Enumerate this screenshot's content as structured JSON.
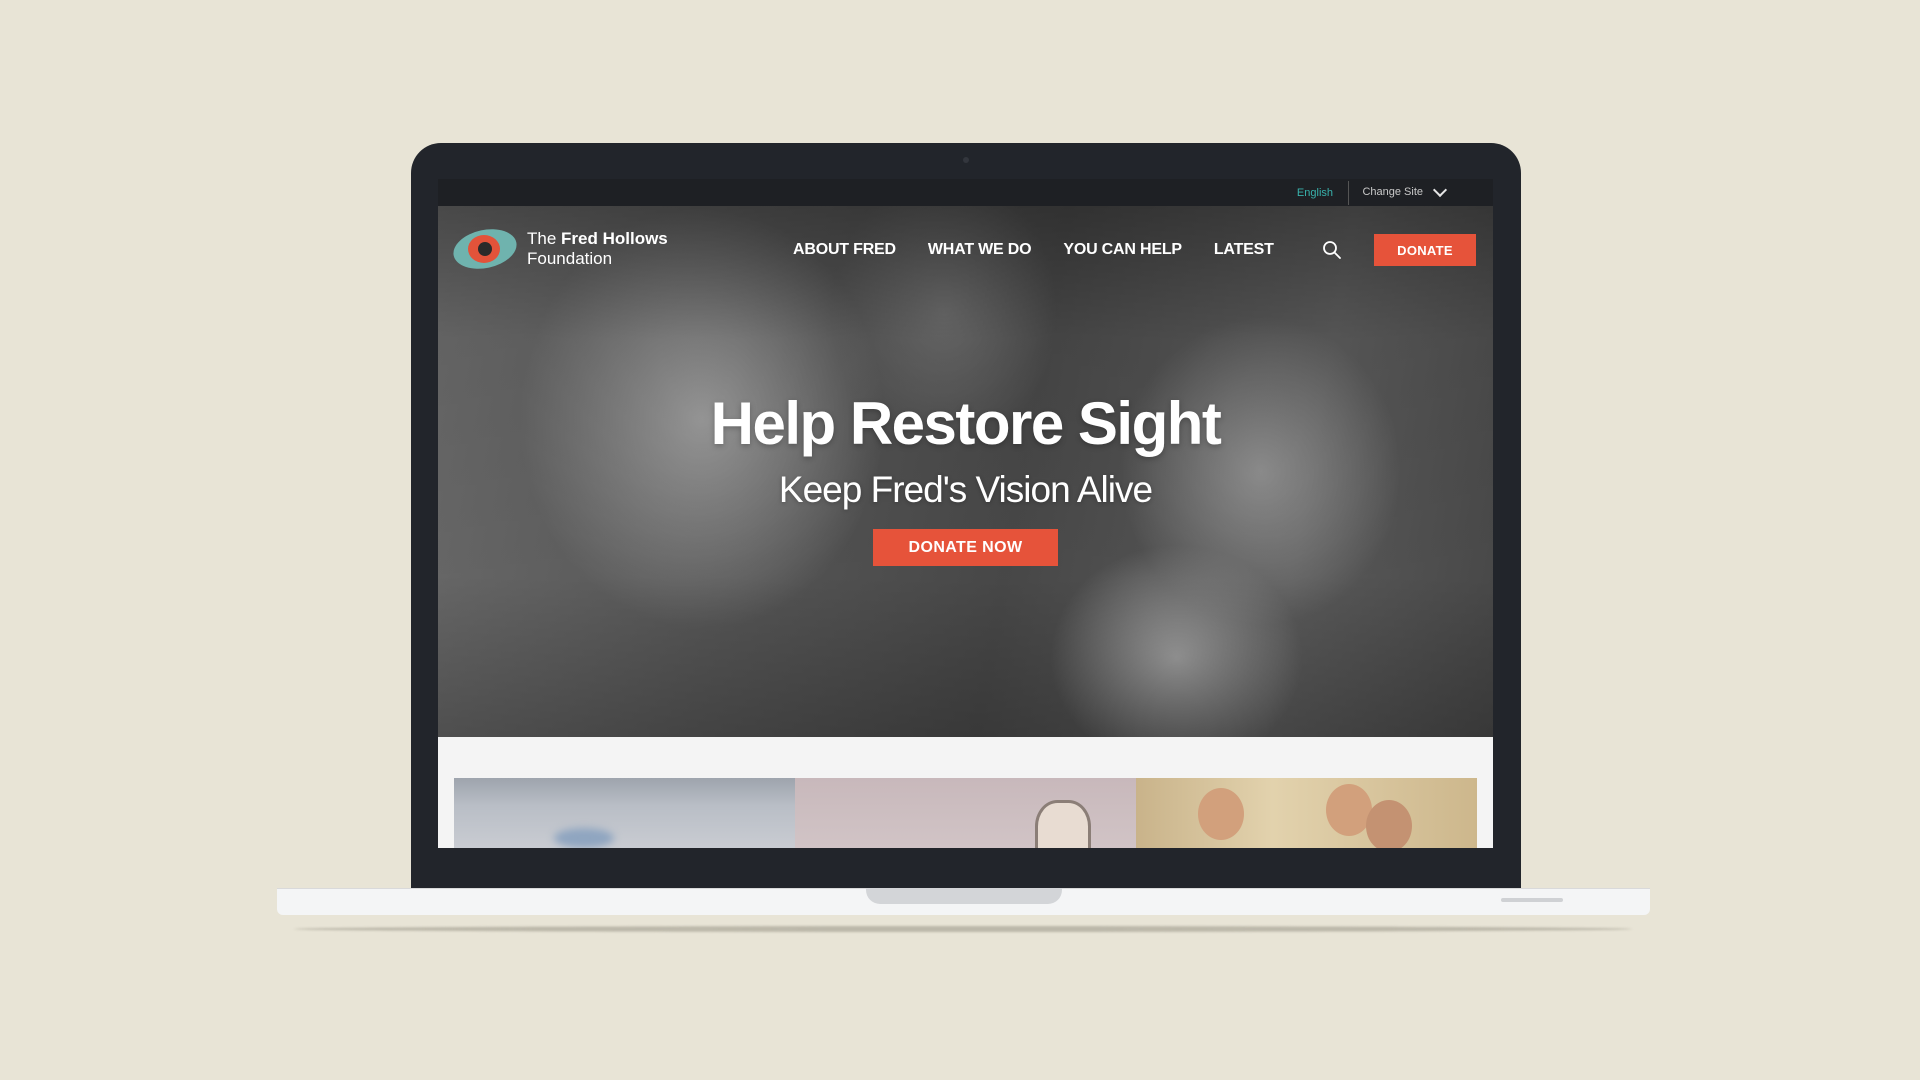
{
  "utility_bar": {
    "language": "English",
    "change_site": "Change Site"
  },
  "brand": {
    "line1_prefix": "The ",
    "line1_bold": "Fred Hollows",
    "line2": "Foundation"
  },
  "nav": {
    "items": [
      {
        "label": "ABOUT FRED"
      },
      {
        "label": "WHAT WE DO"
      },
      {
        "label": "YOU CAN HELP"
      },
      {
        "label": "LATEST"
      }
    ],
    "donate_label": "DONATE"
  },
  "hero": {
    "title": "Help Restore Sight",
    "subtitle": "Keep Fred's Vision Alive",
    "cta_label": "DONATE NOW"
  },
  "colors": {
    "accent": "#e6533a",
    "teal": "#38b2ac",
    "logo_teal": "#6fb3ae",
    "utility_bg": "#1e2024",
    "background": "#e8e4d6"
  },
  "icons": [
    "search-icon",
    "chevron-down-icon",
    "logo-eye-icon"
  ]
}
